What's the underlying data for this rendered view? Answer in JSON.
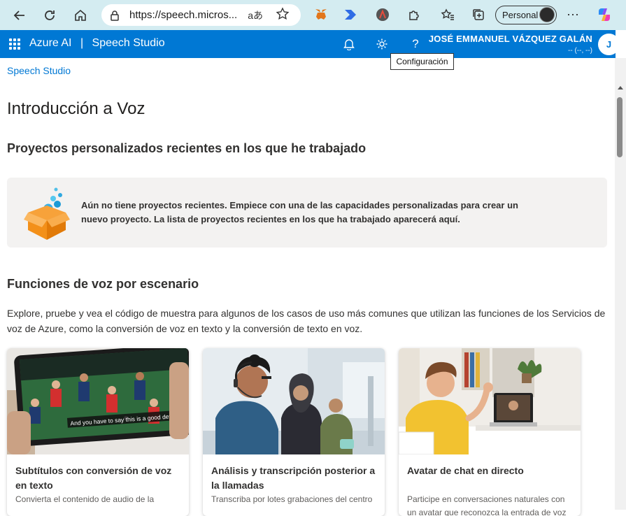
{
  "browser": {
    "url": "https://speech.micros...",
    "read_aloud_glyph": "aあ",
    "profile_label": "Personal"
  },
  "header": {
    "brand": "Azure AI",
    "separator": "|",
    "product": "Speech Studio",
    "user_name": "JOSÉ EMMANUEL VÁZQUEZ GALÁN",
    "user_sub": "-- (--, --)",
    "avatar_initial": "J",
    "tooltip": "Configuración"
  },
  "page": {
    "breadcrumb": "Speech Studio",
    "title": "Introducción a Voz",
    "recent_heading": "Proyectos personalizados recientes en los que he trabajado",
    "empty_message": "Aún no tiene proyectos recientes. Empiece con una de las capacidades personalizadas para crear un nuevo proyecto. La lista de proyectos recientes en los que ha trabajado aparecerá aquí.",
    "scenario_heading": "Funciones de voz por escenario",
    "scenario_desc": "Explore, pruebe y vea el código de muestra para algunos de los casos de uso más comunes que utilizan las funciones de los Servicios de voz de Azure, como la conversión de voz en texto y la conversión de texto en voz."
  },
  "cards": [
    {
      "title": "Subtítulos con conversión de voz en texto",
      "text": "Convierta el contenido de audio de la",
      "caption": "And you have to say this is a good defense."
    },
    {
      "title": "Análisis y transcripción posterior a la llamadas",
      "text": "Transcriba por lotes grabaciones del centro"
    },
    {
      "title": "Avatar de chat en directo",
      "text": "Participe en conversaciones naturales con un avatar que reconozca la entrada de voz"
    }
  ]
}
